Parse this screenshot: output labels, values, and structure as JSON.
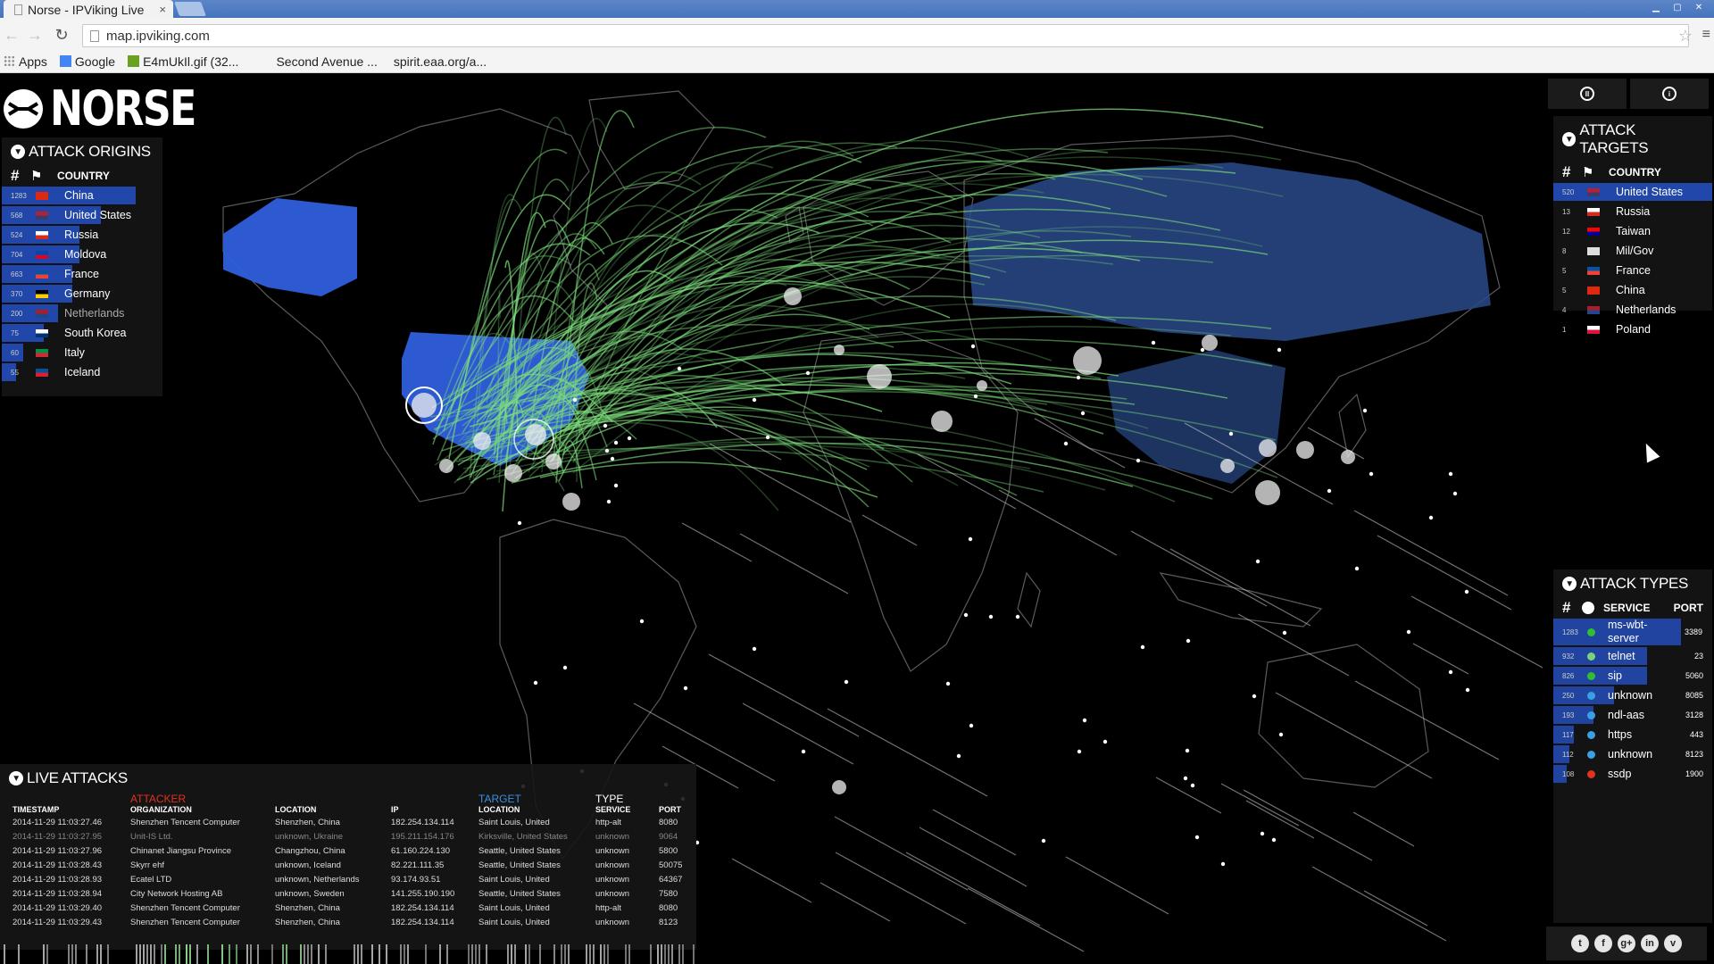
{
  "browser": {
    "tab_title": "Norse - IPViking Live",
    "tab_close": "×",
    "url": "map.ipviking.com",
    "bookmarks": [
      {
        "label": "Apps",
        "icon": "apps-grid-icon",
        "color": "#888888"
      },
      {
        "label": "Google",
        "icon": "google-icon",
        "color": "#4285f4"
      },
      {
        "label": "E4mUkIl.gif (32...",
        "icon": "image-icon",
        "color": "#6aa121"
      },
      {
        "label": "Second Avenue ...",
        "icon": "page-icon",
        "color": "#f4f4f4"
      },
      {
        "label": "spirit.eaa.org/a...",
        "icon": "plane-icon",
        "color": "#f4f4f4"
      }
    ]
  },
  "logo": {
    "text": "NORSE"
  },
  "colors": {
    "accent_blue": "#2f5fdc",
    "attack_green": "#7cdc7c",
    "attacker_red": "#e0321e",
    "target_blue": "#3a8fe4"
  },
  "attack_origins": {
    "title": "Attack Origins",
    "header_country": "Country",
    "rows": [
      {
        "count": "1283",
        "country": "China",
        "flag": [
          "#de2910",
          "#de2910"
        ],
        "share": 0.95
      },
      {
        "count": "568",
        "country": "United States",
        "flag": [
          "#b22234",
          "#3c3b6e"
        ],
        "share": 0.7
      },
      {
        "count": "524",
        "country": "Russia",
        "flag": [
          "#ffffff",
          "#d52b1e"
        ],
        "share": 0.55
      },
      {
        "count": "704",
        "country": "Moldova",
        "flag": [
          "#0046ae",
          "#cc092f"
        ],
        "share": 0.55
      },
      {
        "count": "663",
        "country": "France",
        "flag": [
          "#0055a4",
          "#ef4135"
        ],
        "share": 0.5
      },
      {
        "count": "370",
        "country": "Germany",
        "flag": [
          "#000000",
          "#ffce00"
        ],
        "share": 0.5
      },
      {
        "count": "200",
        "country": "Netherlands",
        "flag": [
          "#ae1c28",
          "#21468b"
        ],
        "share": 0.4,
        "dim": true
      },
      {
        "count": "75",
        "country": "South Korea",
        "flag": [
          "#ffffff",
          "#003478"
        ],
        "share": 0.3
      },
      {
        "count": "60",
        "country": "Italy",
        "flag": [
          "#009246",
          "#ce2b37"
        ],
        "share": 0.15
      },
      {
        "count": "55",
        "country": "Iceland",
        "flag": [
          "#02529c",
          "#dc1e35"
        ],
        "share": 0.1
      }
    ]
  },
  "attack_targets": {
    "title": "Attack Targets",
    "header_country": "Country",
    "rows": [
      {
        "count": "520",
        "country": "United States",
        "flag": [
          "#b22234",
          "#3c3b6e"
        ],
        "share": 1.0
      },
      {
        "count": "13",
        "country": "Russia",
        "flag": [
          "#ffffff",
          "#d52b1e"
        ],
        "share": 0.0
      },
      {
        "count": "12",
        "country": "Taiwan",
        "flag": [
          "#fe0000",
          "#000095"
        ],
        "share": 0.0
      },
      {
        "count": "8",
        "country": "Mil/Gov",
        "flag": [
          "#dddddd",
          "#dddddd"
        ],
        "share": 0.0
      },
      {
        "count": "5",
        "country": "France",
        "flag": [
          "#0055a4",
          "#ef4135"
        ],
        "share": 0.0
      },
      {
        "count": "5",
        "country": "China",
        "flag": [
          "#de2910",
          "#de2910"
        ],
        "share": 0.0
      },
      {
        "count": "4",
        "country": "Netherlands",
        "flag": [
          "#ae1c28",
          "#21468b"
        ],
        "share": 0.0
      },
      {
        "count": "1",
        "country": "Poland",
        "flag": [
          "#ffffff",
          "#dc143c"
        ],
        "share": 0.0
      }
    ]
  },
  "attack_types": {
    "title": "Attack Types",
    "header_service": "Service",
    "header_port": "Port",
    "rows": [
      {
        "count": "1283",
        "service": "ms-wbt-server",
        "port": "3389",
        "dot": "#2fbf2f",
        "share": 0.95
      },
      {
        "count": "932",
        "service": "telnet",
        "port": "23",
        "dot": "#7cd27c",
        "share": 0.7
      },
      {
        "count": "826",
        "service": "sip",
        "port": "5060",
        "dot": "#2fbf2f",
        "share": 0.7
      },
      {
        "count": "250",
        "service": "unknown",
        "port": "8085",
        "dot": "#3aa0e4",
        "share": 0.45
      },
      {
        "count": "193",
        "service": "ndl-aas",
        "port": "3128",
        "dot": "#3aa0e4",
        "share": 0.3
      },
      {
        "count": "117",
        "service": "https",
        "port": "443",
        "dot": "#3aa0e4",
        "share": 0.15
      },
      {
        "count": "112",
        "service": "unknown",
        "port": "8123",
        "dot": "#3aa0e4",
        "share": 0.12
      },
      {
        "count": "108",
        "service": "ssdp",
        "port": "1900",
        "dot": "#e0321e",
        "share": 0.1
      }
    ]
  },
  "live_attacks": {
    "title": "Live Attacks",
    "attacker_label": "Attacker",
    "target_label": "Target",
    "type_label": "Type",
    "columns": {
      "timestamp": "Timestamp",
      "organization": "Organization",
      "location": "Location",
      "ip": "IP",
      "target_location": "Location",
      "service": "Service",
      "port": "Port"
    },
    "rows": [
      {
        "timestamp": "2014-11-29 11:03:27.46",
        "organization": "Shenzhen Tencent Computer",
        "location": "Shenzhen, China",
        "ip": "182.254.134.114",
        "target": "Saint Louis, United",
        "service": "http-alt",
        "port": "8080"
      },
      {
        "timestamp": "2014-11-29 11:03:27.95",
        "organization": "Unit-IS Ltd.",
        "location": "unknown, Ukraine",
        "ip": "195.211.154.176",
        "target": "Kirksville, United States",
        "service": "unknown",
        "port": "9064",
        "dim": true
      },
      {
        "timestamp": "2014-11-29 11:03:27.96",
        "organization": "Chinanet Jiangsu Province",
        "location": "Changzhou, China",
        "ip": "61.160.224.130",
        "target": "Seattle, United States",
        "service": "unknown",
        "port": "5800"
      },
      {
        "timestamp": "2014-11-29 11:03:28.43",
        "organization": "Skyrr ehf",
        "location": "unknown, Iceland",
        "ip": "82.221.111.35",
        "target": "Seattle, United States",
        "service": "unknown",
        "port": "50075"
      },
      {
        "timestamp": "2014-11-29 11:03:28.93",
        "organization": "Ecatel LTD",
        "location": "unknown, Netherlands",
        "ip": "93.174.93.51",
        "target": "Saint Louis, United",
        "service": "unknown",
        "port": "64367"
      },
      {
        "timestamp": "2014-11-29 11:03:28.94",
        "organization": "City Network Hosting AB",
        "location": "unknown, Sweden",
        "ip": "141.255.190.190",
        "target": "Seattle, United States",
        "service": "unknown",
        "port": "7580"
      },
      {
        "timestamp": "2014-11-29 11:03:29.40",
        "organization": "Shenzhen Tencent Computer",
        "location": "Shenzhen, China",
        "ip": "182.254.134.114",
        "target": "Saint Louis, United",
        "service": "http-alt",
        "port": "8080"
      },
      {
        "timestamp": "2014-11-29 11:03:29.43",
        "organization": "Shenzhen Tencent Computer",
        "location": "Shenzhen, China",
        "ip": "182.254.134.114",
        "target": "Saint Louis, United",
        "service": "unknown",
        "port": "8123"
      }
    ]
  },
  "controls": {
    "pause_icon": "pause-icon",
    "info_icon": "info-icon"
  },
  "social": [
    "t",
    "f",
    "g+",
    "in",
    "v"
  ]
}
